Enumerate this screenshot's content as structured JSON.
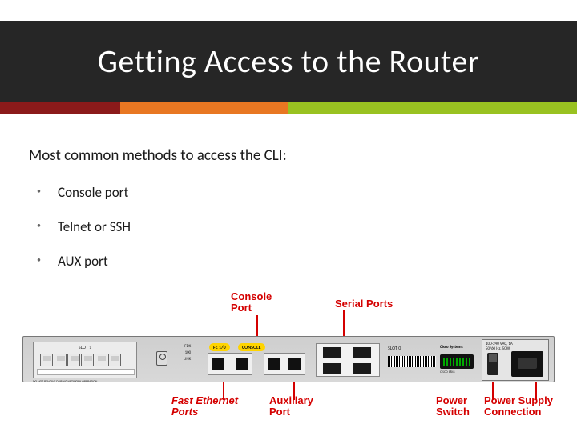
{
  "title": "Getting Access to the Router",
  "lead": "Most common methods to access the CLI:",
  "bullets": [
    "Console port",
    "Telnet or SSH",
    "AUX port"
  ],
  "router": {
    "slot_label": "SLOT 1",
    "dont_remove": "DO NOT REMOVE DURING NETWORK OPERATION",
    "leds": [
      "FDX",
      "100",
      "LINK",
      "FDX",
      "100",
      "LINK"
    ],
    "pill_fe": "FE 1/0",
    "pill_console": "CONSOLE",
    "serial_caption": "SLOT 0",
    "brand_small": "Cisco Systems",
    "model": "CISCO 1841",
    "power_text": "100-240 VAC, 1A\n50/60 Hz, 50W"
  },
  "callouts": {
    "console": "Console\nPort",
    "serial": "Serial Ports",
    "fe": "Fast Ethernet\nPorts",
    "aux": "Auxillary\nPort",
    "psw": "Power\nSwitch",
    "psu": "Power Supply\nConnection"
  }
}
